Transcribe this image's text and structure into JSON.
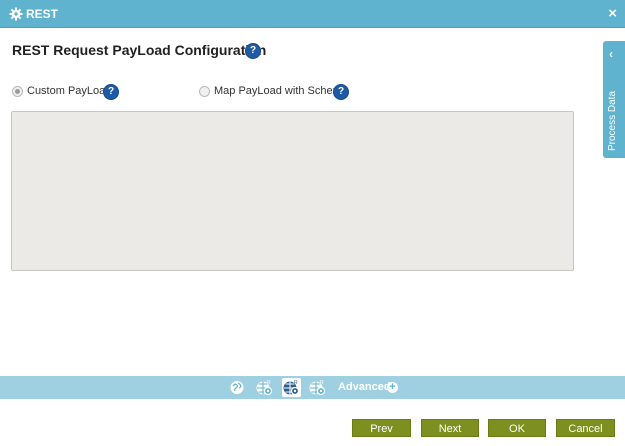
{
  "window": {
    "title": "REST",
    "close_glyph": "×"
  },
  "page": {
    "title": "REST Request PayLoad Configuration",
    "help_glyph": "?"
  },
  "options": [
    {
      "label": "Custom PayLoad",
      "selected": true
    },
    {
      "label": "Map PayLoad with Schema",
      "selected": false
    }
  ],
  "side_panel": {
    "label": "Process Data",
    "chevron": "‹"
  },
  "nav": {
    "icons": [
      "globe-icon",
      "globe-settings-icon",
      "globe-payload-icon",
      "globe-response-icon"
    ],
    "active_index": 2,
    "advanced_label": "Advanced",
    "advanced_glyph": "+"
  },
  "buttons": {
    "prev": "Prev",
    "next": "Next",
    "ok": "OK",
    "cancel": "Cancel"
  },
  "colors": {
    "header": "#5fb3cf",
    "nav_strip": "#9fd0e1",
    "button": "#7d8f1e",
    "payload_bg": "#eceae6",
    "help": "#1e5aa6"
  }
}
